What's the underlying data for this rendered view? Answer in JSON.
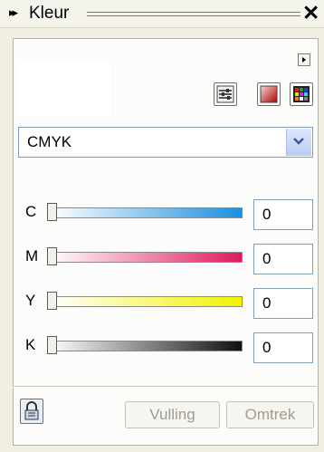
{
  "window": {
    "title": "Kleur",
    "collapse_icon": "double-chevron-right-icon",
    "close_glyph": "✕"
  },
  "color_model": {
    "selected": "CMYK"
  },
  "channels": [
    {
      "label": "C",
      "value": "0",
      "gradient_end": "#1a8fe0"
    },
    {
      "label": "M",
      "value": "0",
      "gradient_end": "#e01a5a"
    },
    {
      "label": "Y",
      "value": "0",
      "gradient_end": "#f2f200"
    },
    {
      "label": "K",
      "value": "0",
      "gradient_end": "#111111"
    }
  ],
  "buttons": {
    "fill": "Vulling",
    "stroke": "Omtrek"
  },
  "icons": {
    "sliders": "sliders-icon",
    "color_viewer": "color-viewer-icon",
    "palette": "palette-grid-icon",
    "flyout": "flyout-menu-icon",
    "lock": "lock-icon",
    "dropdown": "chevron-down-icon"
  }
}
